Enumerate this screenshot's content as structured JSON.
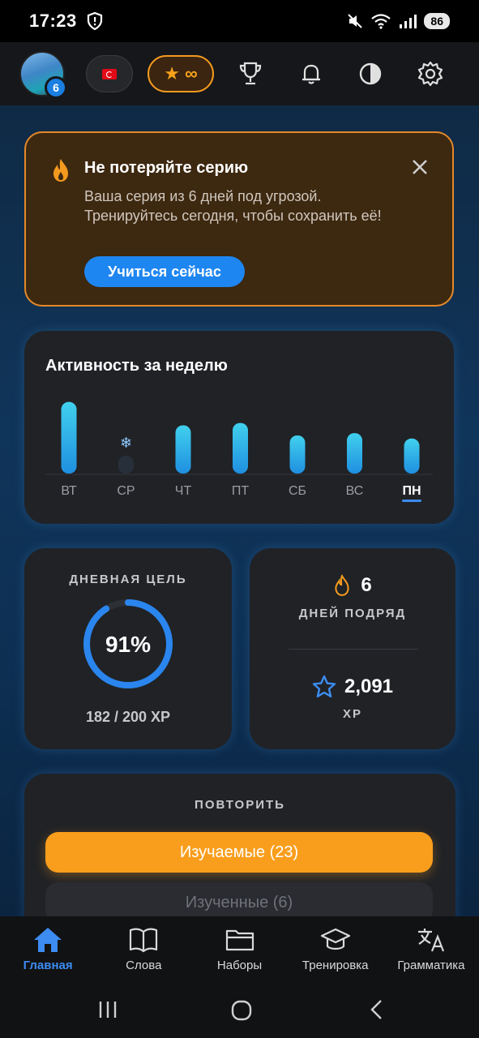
{
  "status_bar": {
    "time": "17:23",
    "battery": "86"
  },
  "header": {
    "avatar_badge": "6",
    "stars_value": "∞"
  },
  "alert": {
    "title": "Не потеряйте серию",
    "text": "Ваша серия из 6 дней под угрозой. Тренируйтесь сегодня, чтобы сохранить её!",
    "button": "Учиться сейчас"
  },
  "weekly": {
    "title": "Активность за неделю",
    "chart_data": {
      "type": "bar",
      "categories": [
        "ВТ",
        "СР",
        "ЧТ",
        "ПТ",
        "СБ",
        "ВС",
        "ПН"
      ],
      "values": [
        92,
        0,
        62,
        65,
        49,
        52,
        45
      ],
      "frozen_day": "СР",
      "current_day": "ПН",
      "bar_color": "#2bb6e8"
    }
  },
  "daily_goal": {
    "label": "ДНЕВНАЯ ЦЕЛЬ",
    "percent_text": "91%",
    "percent": 0.91,
    "xp_text": "182 / 200 XP"
  },
  "streak": {
    "days": "6",
    "label": "ДНЕЙ ПОДРЯД",
    "xp_total": "2,091",
    "xp_label": "XP"
  },
  "repeat": {
    "label": "ПОВТОРИТЬ",
    "learning_btn": "Изучаемые (23)",
    "learned_btn": "Изученные (6)"
  },
  "nav": {
    "home": "Главная",
    "words": "Слова",
    "sets": "Наборы",
    "training": "Тренировка",
    "grammar": "Грамматика"
  },
  "colors": {
    "accent": "#3d8cf2",
    "orange": "#f99e1c",
    "alert_border": "#e4892a"
  }
}
